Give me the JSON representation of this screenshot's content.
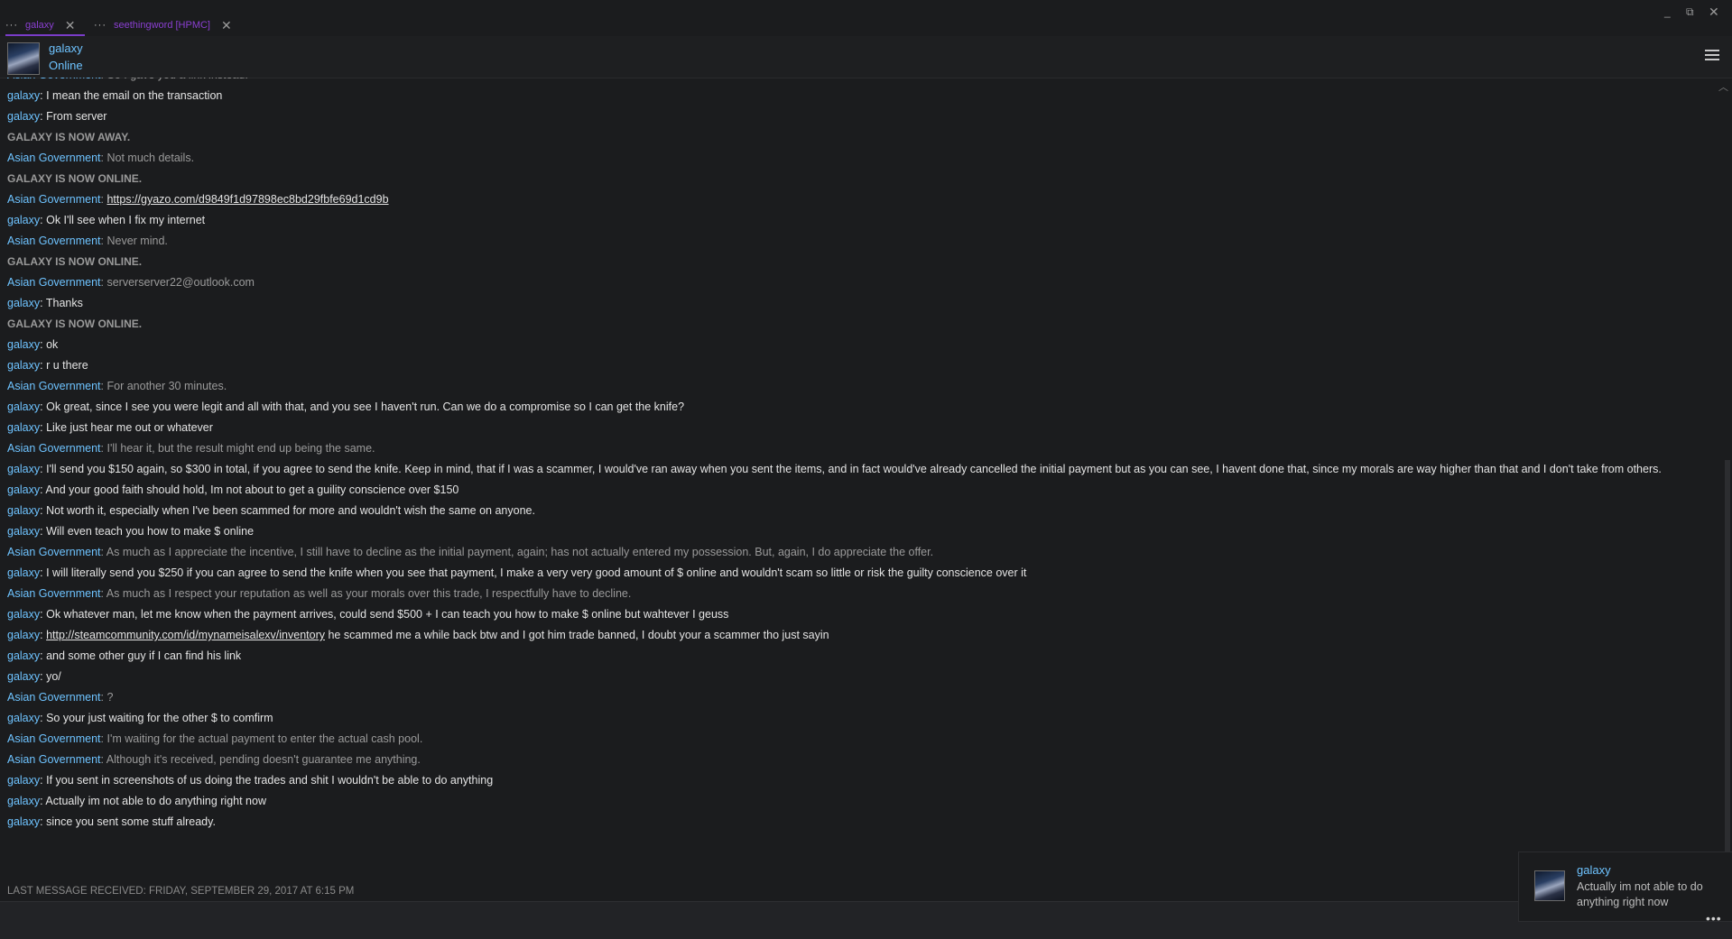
{
  "tabs": [
    {
      "label": "galaxy",
      "active": true
    },
    {
      "label": "seethingword [HPMC]",
      "active": false
    }
  ],
  "header": {
    "name": "galaxy",
    "status": "Online"
  },
  "chat": [
    {
      "kind": "them",
      "who": "Asian Government",
      "text": "So I gave you a link instead."
    },
    {
      "kind": "me",
      "who": "galaxy",
      "text": "I mean the email on the transaction"
    },
    {
      "kind": "me",
      "who": "galaxy",
      "text": "From server"
    },
    {
      "kind": "status",
      "text": "GALAXY IS NOW AWAY."
    },
    {
      "kind": "them",
      "who": "Asian Government",
      "text": "Not much details."
    },
    {
      "kind": "status",
      "text": "GALAXY IS NOW ONLINE."
    },
    {
      "kind": "them",
      "who": "Asian Government",
      "link": "https://gyazo.com/d9849f1d97898ec8bd29fbfe69d1cd9b"
    },
    {
      "kind": "me",
      "who": "galaxy",
      "text": "Ok I'll see when I fix my internet"
    },
    {
      "kind": "them",
      "who": "Asian Government",
      "text": "Never mind."
    },
    {
      "kind": "status",
      "text": "GALAXY IS NOW ONLINE."
    },
    {
      "kind": "them",
      "who": "Asian Government",
      "text": "serverserver22@outlook.com"
    },
    {
      "kind": "me",
      "who": "galaxy",
      "text": "Thanks"
    },
    {
      "kind": "status",
      "text": "GALAXY IS NOW ONLINE."
    },
    {
      "kind": "me",
      "who": "galaxy",
      "text": "ok"
    },
    {
      "kind": "me",
      "who": "galaxy",
      "text": "r u there"
    },
    {
      "kind": "them",
      "who": "Asian Government",
      "text": "For another 30 minutes."
    },
    {
      "kind": "me",
      "who": "galaxy",
      "text": "Ok great, since I see you were legit and all with that, and you see I haven't run. Can we do a compromise so I can get the knife?"
    },
    {
      "kind": "me",
      "who": "galaxy",
      "text": "Like just hear me out or whatever"
    },
    {
      "kind": "them",
      "who": "Asian Government",
      "text": "I'll hear it, but the result might end up being the same."
    },
    {
      "kind": "me",
      "who": "galaxy",
      "text": "I'll send you $150 again, so $300 in total, if you agree to send the knife. Keep in mind, that if I was a scammer, I would've ran away when you sent the items, and in fact would've already cancelled the initial payment but as you can see, I havent done that, since my morals are way higher than that and I don't take from others."
    },
    {
      "kind": "me",
      "who": "galaxy",
      "text": "And your good faith should hold, Im not about to get a guility conscience over $150"
    },
    {
      "kind": "me",
      "who": "galaxy",
      "text": "Not worth it, especially when I've been scammed for more and wouldn't wish the same on anyone."
    },
    {
      "kind": "me",
      "who": "galaxy",
      "text": "Will even teach you how to make $ online"
    },
    {
      "kind": "them",
      "who": "Asian Government",
      "text": "As much as I appreciate the incentive, I still have to decline as the initial payment, again; has not actually entered my possession. But, again, I do appreciate the offer."
    },
    {
      "kind": "me",
      "who": "galaxy",
      "text": "I will literally send you $250 if you can agree to send the knife when you see that payment, I make a very very good amount of $ online and wouldn't scam so little or risk the guilty conscience over it"
    },
    {
      "kind": "them",
      "who": "Asian Government",
      "text": "As much as I respect your reputation as well as your morals over this trade, I respectfully have to decline."
    },
    {
      "kind": "me",
      "who": "galaxy",
      "text": "Ok whatever man, let me know when the payment arrives, could send $500 + I can teach you how to make $ online but wahtever I geuss"
    },
    {
      "kind": "me",
      "who": "galaxy",
      "link": "http://steamcommunity.com/id/mynameisalexv/inventory",
      "text": " he scammed me a while back btw and I got him trade banned, I doubt your a scammer tho just sayin"
    },
    {
      "kind": "me",
      "who": "galaxy",
      "text": "and some other guy if I can find his link"
    },
    {
      "kind": "me",
      "who": "galaxy",
      "text": "yo/"
    },
    {
      "kind": "them",
      "who": "Asian Government",
      "text": "?"
    },
    {
      "kind": "me",
      "who": "galaxy",
      "text": "So your just waiting for the other $ to comfirm"
    },
    {
      "kind": "them",
      "who": "Asian Government",
      "text": "I'm waiting for the actual payment to enter the actual cash pool."
    },
    {
      "kind": "them",
      "who": "Asian Government",
      "text": "Although it's received, pending doesn't guarantee me anything."
    },
    {
      "kind": "me",
      "who": "galaxy",
      "text": "If you sent in screenshots of us doing the trades and shit I wouldn't be able to do anything"
    },
    {
      "kind": "me",
      "who": "galaxy",
      "text": "Actually im not able to do anything right now"
    },
    {
      "kind": "me",
      "who": "galaxy",
      "text": "since you sent some stuff already."
    }
  ],
  "footer": {
    "last_received": "LAST MESSAGE RECEIVED: FRIDAY, SEPTEMBER 29, 2017 AT 6:15 PM"
  },
  "notification": {
    "name": "galaxy",
    "text": "Actually im not able to do anything right now"
  },
  "colors": {
    "accent": "#6ec3ff",
    "tab": "#8a3fd1",
    "background": "#1b1c1e"
  }
}
